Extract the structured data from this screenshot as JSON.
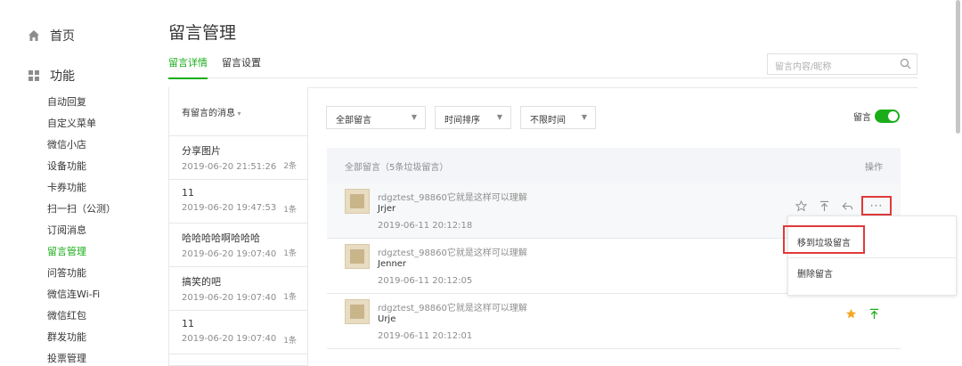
{
  "sidebar": {
    "home": {
      "label": "首页"
    },
    "features": {
      "label": "功能"
    },
    "items": [
      {
        "label": "自动回复"
      },
      {
        "label": "自定义菜单"
      },
      {
        "label": "微信小店"
      },
      {
        "label": "设备功能"
      },
      {
        "label": "卡券功能"
      },
      {
        "label": "扫一扫（公测）"
      },
      {
        "label": "订阅消息"
      },
      {
        "label": "留言管理",
        "active": true
      },
      {
        "label": "问答功能"
      },
      {
        "label": "微信连Wi-Fi"
      },
      {
        "label": "微信红包"
      },
      {
        "label": "群发功能"
      },
      {
        "label": "投票管理"
      }
    ]
  },
  "page": {
    "title": "留言管理",
    "tabs": [
      {
        "label": "留言详情"
      },
      {
        "label": "留言设置"
      }
    ],
    "search_placeholder": "留言内容/昵称"
  },
  "message_list": {
    "header": "有留言的消息",
    "items": [
      {
        "title": "分享图片",
        "time": "2019-06-20 21:51:26",
        "count": "2条"
      },
      {
        "title": "11",
        "time": "2019-06-20 19:47:53",
        "count": "1条"
      },
      {
        "title": "哈哈哈哈啊哈哈哈",
        "time": "2019-06-20 19:07:40",
        "count": "1条"
      },
      {
        "title": "搞笑的吧",
        "time": "2019-06-20 19:07:40",
        "count": "1条"
      },
      {
        "title": "11",
        "time": "2019-06-20 19:07:40",
        "count": "1条"
      }
    ]
  },
  "filters": {
    "all": "全部留言",
    "sort": "时间排序",
    "time": "不限时间",
    "toggle_label": "留言"
  },
  "comments": {
    "header": "全部留言（5条垃圾留言）",
    "operation": "操作",
    "rows": [
      {
        "user": "rdgztest_98860它就是这样可以理解",
        "text": "Jrjer",
        "time": "2019-06-11 20:12:18"
      },
      {
        "user": "rdgztest_98860它就是这样可以理解",
        "text": "Jenner",
        "time": "2019-06-11 20:12:05"
      },
      {
        "user": "rdgztest_98860它就是这样可以理解",
        "text": "Urje",
        "time": "2019-06-11 20:12:01"
      }
    ],
    "more_label": "···"
  },
  "dropdown": {
    "move_to_spam": "移到垃圾留言",
    "delete": "删除留言"
  },
  "colors": {
    "accent": "#1aad19",
    "highlight": "#e03a3a",
    "star": "#f5a623"
  }
}
